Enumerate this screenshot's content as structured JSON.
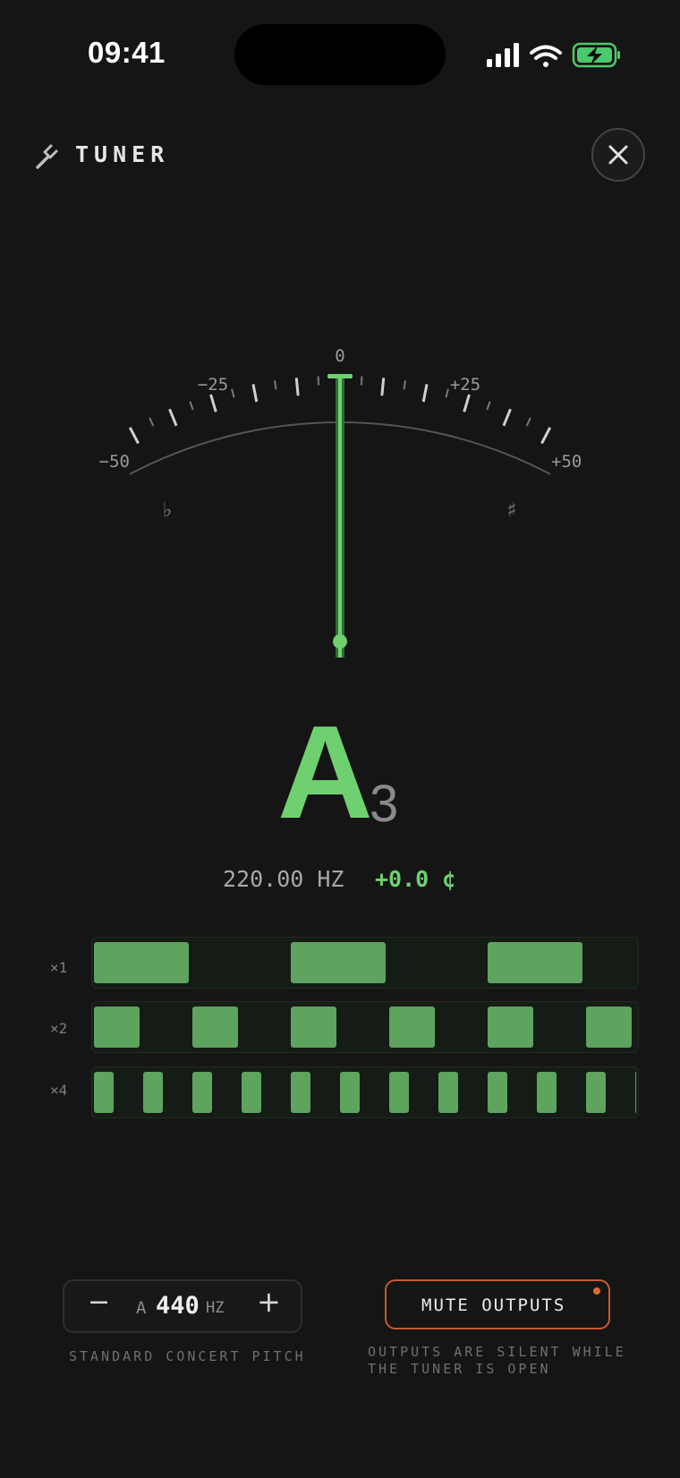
{
  "status_bar": {
    "time": "09:41",
    "icons": [
      "cellular-signal-icon",
      "wifi-icon",
      "battery-charging-icon"
    ]
  },
  "header": {
    "icon": "tuning-fork-icon",
    "title": "TUNER",
    "close_icon": "close-icon"
  },
  "meter": {
    "labels": {
      "minus50": "−50",
      "minus25": "−25",
      "zero": "0",
      "plus25": "+25",
      "plus50": "+50"
    },
    "flat_symbol": "♭",
    "sharp_symbol": "♯",
    "cents_offset": 0.0,
    "colors": {
      "needle": "#6fd06f",
      "scale": "#cfcfcf"
    }
  },
  "reading": {
    "note": "A",
    "octave": "3",
    "frequency": "220.00 HZ",
    "cents": "+0.0 ¢"
  },
  "harmonics": [
    {
      "label": "×1"
    },
    {
      "label": "×2"
    },
    {
      "label": "×4"
    }
  ],
  "reference_pitch": {
    "minus_label": "−",
    "plus_label": "+",
    "note": "A",
    "value": "440",
    "unit": "HZ",
    "caption": "STANDARD CONCERT PITCH"
  },
  "mute": {
    "label": "MUTE OUTPUTS",
    "caption_line1": "OUTPUTS ARE SILENT WHILE",
    "caption_line2": "THE TUNER IS OPEN",
    "accent_color": "#c75a2e"
  }
}
